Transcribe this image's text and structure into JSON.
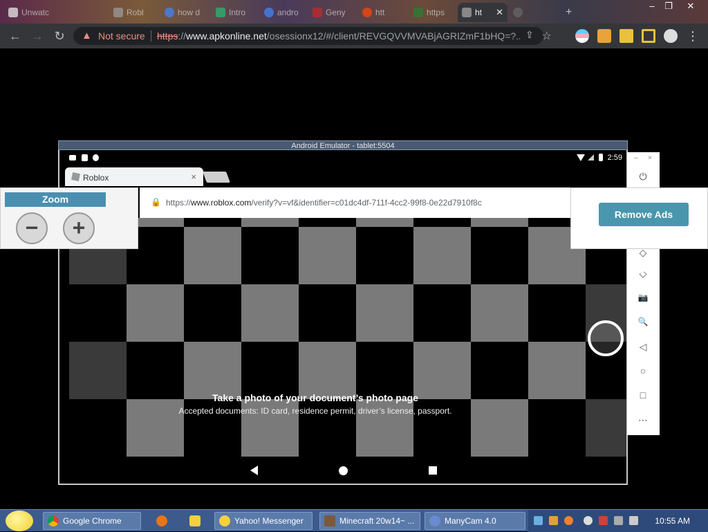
{
  "browser": {
    "tabs": [
      {
        "label": "Unwatc",
        "color": "#e8e8e8"
      },
      {
        "label": "Robl",
        "color": "#9a9a9a"
      },
      {
        "label": "how d",
        "color": "#4285f4"
      },
      {
        "label": "Intro",
        "color": "#2bb673"
      },
      {
        "label": "andro",
        "color": "#4285f4"
      },
      {
        "label": "Geny",
        "color": "#c62828"
      },
      {
        "label": "htt",
        "color": "#ff4500"
      },
      {
        "label": "https",
        "color": "#2e7d32"
      },
      {
        "label": "ht",
        "color": "#888888",
        "active": true
      },
      {
        "label": "",
        "color": "#666666"
      }
    ],
    "new_tab": "+",
    "window_controls": [
      "–",
      "❐",
      "✕"
    ],
    "nav": {
      "back": "←",
      "forward": "→",
      "reload": "↻"
    },
    "security_label": "Not secure",
    "url": {
      "proto": "https",
      "rest_before": "://",
      "host": "www.apkonline.net",
      "path": "/osessionx12/#/client/REVGQVVMVABjAGRIZmF1bHQ=?..."
    },
    "icons": [
      "share-icon",
      "bookmark-star-icon",
      "profile-icon",
      "extensions-icon",
      "menu-icon"
    ],
    "menu": "⋮"
  },
  "emulator": {
    "title": "Android Emulator - tablet:5504",
    "clock": "2:59",
    "android_chrome": {
      "tab_label": "Roblox",
      "tab_close": "×",
      "url_proto": "https://",
      "url_host": "www.roblox.com",
      "url_path": "/verify?v=vf&identifier=c01dc4df-711f-4cc2-99f8-0e22d7910f8c"
    },
    "camera": {
      "title": "Take a photo of your document’s photo page",
      "subtitle": "Accepted documents: ID card, residence permit, driver’s license, passport."
    },
    "side_buttons": [
      "power-icon",
      "volume-up-icon",
      "volume-down-icon",
      "rotate-left-icon",
      "rotate-right-icon",
      "camera-icon",
      "zoom-icon",
      "back-icon",
      "home-icon",
      "overview-icon",
      "more-icon"
    ],
    "side_glyphs": {
      "power": "⏻",
      "rotate1": "◇",
      "rotate2": "◇",
      "camera": "📷",
      "zoom": "🔍",
      "back": "◁",
      "home": "○",
      "overview": "□",
      "more": "⋯",
      "minimize": "–",
      "close": "×"
    }
  },
  "zoom_panel": {
    "title": "Zoom",
    "minus": "−",
    "plus": "+"
  },
  "ads_panel": {
    "button": "Remove Ads"
  },
  "taskbar": {
    "tasks": [
      {
        "label": "Google Chrome",
        "color": "#4285f4"
      },
      {
        "label": "Yahoo! Messenger",
        "color": "#f5d040"
      },
      {
        "label": "Minecraft 20w14~ ...",
        "color": "#7a5a3a"
      },
      {
        "label": "ManyCam 4.0",
        "color": "#6a8ad0"
      }
    ],
    "clock": "10:55 AM"
  }
}
